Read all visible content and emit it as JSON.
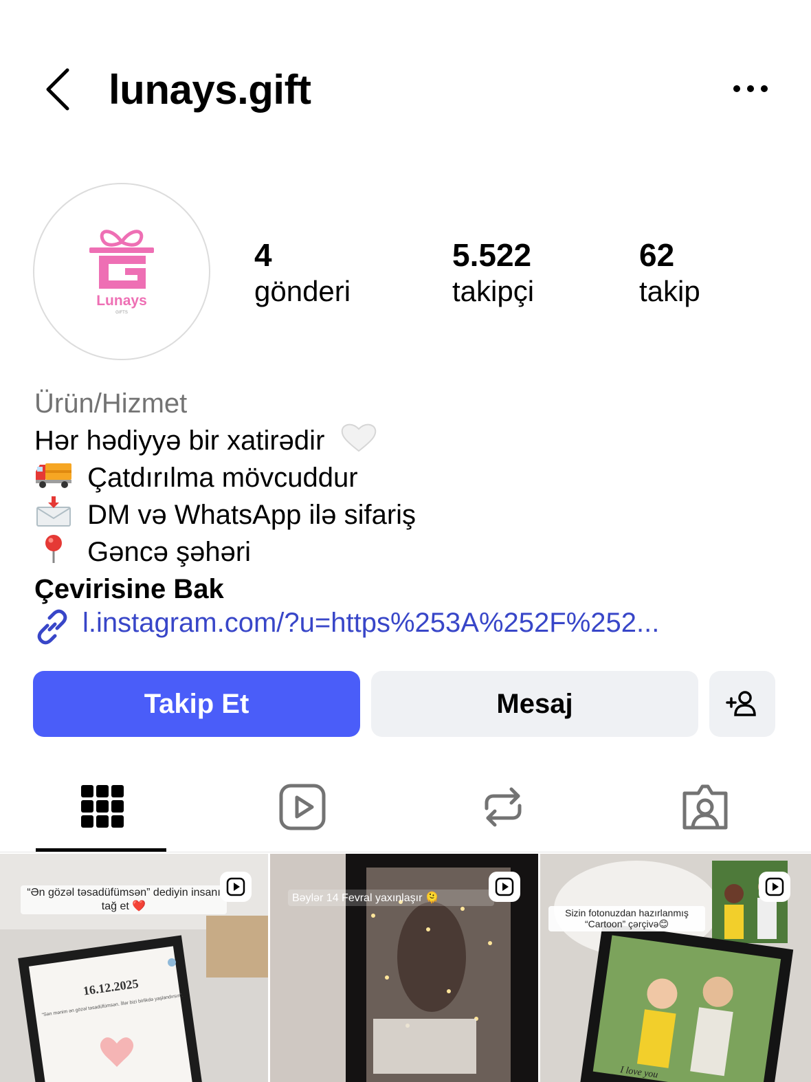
{
  "header": {
    "username": "lunays.gift",
    "back_icon": "chevron-left-icon",
    "more_icon": "more-horizontal-icon"
  },
  "profile": {
    "avatar_brand": "Lunays",
    "avatar_sub": "GIFTS",
    "brand_color": "#ee6fb4",
    "stats": [
      {
        "value": "4",
        "label": "gönderi"
      },
      {
        "value": "5.522",
        "label": "takipçi"
      },
      {
        "value": "62",
        "label": "takip"
      }
    ]
  },
  "bio": {
    "category": "Ürün/Hizmet",
    "lines": [
      {
        "text": "Hər hədiyyə bir xatirədir",
        "emoji": "white-heart"
      },
      {
        "text": "Çatdırılma mövcuddur",
        "emoji": "delivery-truck"
      },
      {
        "text": "DM və WhatsApp ilə sifariş",
        "emoji": "envelope-with-arrow"
      },
      {
        "text": "Gəncə şəhəri",
        "emoji": "round-pushpin"
      }
    ],
    "see_translation": "Çevirisine Bak",
    "link": "l.instagram.com/?u=https%253A%252F%252..."
  },
  "actions": {
    "follow_label": "Takip Et",
    "message_label": "Mesaj",
    "add_user_icon": "add-user-icon",
    "follow_color": "#4a5df9"
  },
  "tabs": [
    {
      "icon": "grid-icon",
      "active": true
    },
    {
      "icon": "reels-icon",
      "active": false
    },
    {
      "icon": "reposts-icon",
      "active": false
    },
    {
      "icon": "tagged-icon",
      "active": false
    }
  ],
  "posts": [
    {
      "caption": "“Ən gözəl təsadüfümsən” dediyin insanı tağ et ❤️",
      "frame_date": "16.12.2025",
      "frame_text": "“Sən mənim ən gözəl təsadüfümsən. İllər bizi birlikdə yaşlandırsın”."
    },
    {
      "caption": "Bəylər 14 Fevral yaxınlaşır 🫠"
    },
    {
      "caption": "Sizin fotonuzdan hazırlanmış “Cartoon” çərçivə😊",
      "frame_text": "I love you"
    }
  ]
}
